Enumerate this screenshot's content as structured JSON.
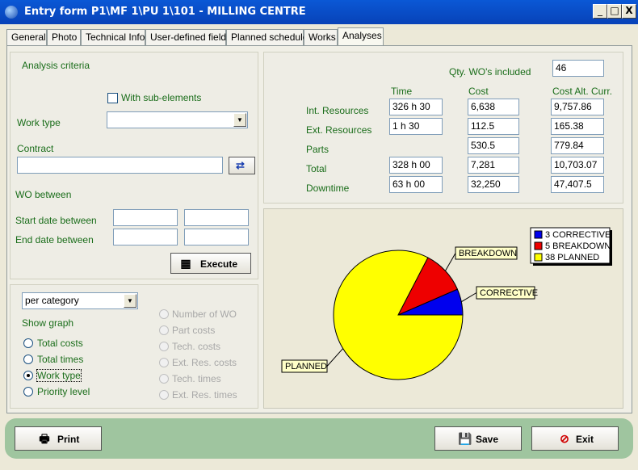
{
  "window": {
    "title": "Entry form P1\\MF 1\\PU 1\\101 - MILLING CENTRE",
    "minimize": "_",
    "maximize": "□",
    "close": "X"
  },
  "tabs": [
    "General",
    "Photo",
    "Technical Info",
    "User-defined fields",
    "Planned schedule",
    "Works",
    "Analyses"
  ],
  "active_tab": "Analyses",
  "criteria": {
    "section_title": "Analysis criteria",
    "with_subelements": "With sub-elements",
    "work_type_label": "Work type",
    "work_type_value": "",
    "contract_label": "Contract",
    "contract_value": "",
    "wo_between": "WO between",
    "start_date_label": "Start date between",
    "end_date_label": "End date between",
    "start_from": "",
    "start_to": "",
    "end_from": "",
    "end_to": "",
    "execute": "Execute"
  },
  "graph_options": {
    "category_select": "per category",
    "show_graph": "Show graph",
    "radios": [
      "Total costs",
      "Total times",
      "Work type",
      "Priority level"
    ],
    "selected": "Work type",
    "disabled_radios": [
      "Number of WO",
      "Part costs",
      "Tech. costs",
      "Ext. Res. costs",
      "Tech. times",
      "Ext. Res. times"
    ]
  },
  "summary": {
    "qty_label": "Qty. WO's included",
    "qty_value": "46",
    "headers": [
      "Time",
      "Cost",
      "Cost Alt. Curr."
    ],
    "rows": [
      {
        "label": "Int. Resources",
        "time": "326 h 30",
        "cost": "6,638",
        "alt": "9,757.86"
      },
      {
        "label": "Ext. Resources",
        "time": "1 h 30",
        "cost": "112.5",
        "alt": "165.38"
      },
      {
        "label": "Parts",
        "time": "",
        "cost": "530.5",
        "alt": "779.84"
      },
      {
        "label": "Total",
        "time": "328 h 00",
        "cost": "7,281",
        "alt": "10,703.07"
      },
      {
        "label": "Downtime",
        "time": "63 h 00",
        "cost": "32,250",
        "alt": "47,407.5"
      }
    ]
  },
  "chart_data": {
    "type": "pie",
    "slices": [
      {
        "name": "CORRECTIVE",
        "value": 3,
        "color": "#0000ee",
        "legend": "3 CORRECTIVE"
      },
      {
        "name": "BREAKDOWN",
        "value": 5,
        "color": "#ee0000",
        "legend": "5 BREAKDOWN"
      },
      {
        "name": "PLANNED",
        "value": 38,
        "color": "#ffff00",
        "legend": "38 PLANNED"
      }
    ],
    "legend_position": "top-right"
  },
  "footer": {
    "print": "Print",
    "save": "Save",
    "exit": "Exit"
  },
  "colors": {
    "label_green": "#1a6d1a",
    "footer_green": "#9fc59f",
    "title_blue": "#0a58d6"
  },
  "icons": {
    "app": "app-icon",
    "print": "printer-icon",
    "save": "save-icon",
    "exit": "exit-icon",
    "execute": "calculator-icon",
    "contract": "contract-picker-icon"
  }
}
